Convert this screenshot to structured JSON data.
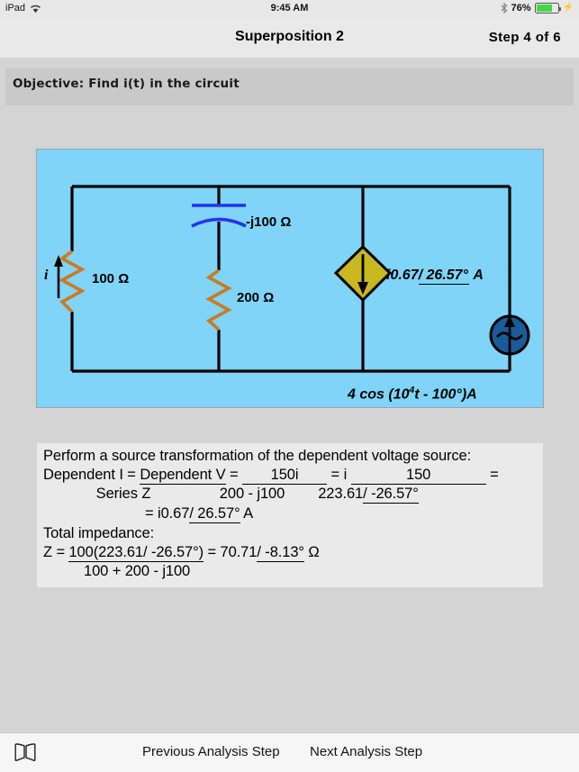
{
  "status_bar": {
    "device": "iPad",
    "wifi_icon": "wifi-icon",
    "time": "9:45 AM",
    "bluetooth_icon": "bluetooth-icon",
    "battery_percent": "76%",
    "battery_level": 76,
    "battery_charging": true
  },
  "nav": {
    "title": "Superposition 2",
    "step": "Step  4 of  6"
  },
  "objective": {
    "text": "Objective: Find i(t) in the circuit"
  },
  "circuit": {
    "background_color": "#7fd4f7",
    "wire_color": "#000000",
    "resistor_color": "#cc7a22",
    "capacitor_color": "#2233ee",
    "dependent_source_color": "#c9b820",
    "independent_source_color": "#1a5c99",
    "current_label": "i",
    "resistor_1_label": "100 Ω",
    "resistor_2_label": "200 Ω",
    "capacitor_label": "-j100 Ω",
    "dependent_source_label_prefix": "i0.67",
    "dependent_source_angle": "26.57°",
    "dependent_source_unit": "A",
    "independent_source_amplitude": "4 cos (10",
    "independent_source_exponent": "4",
    "independent_source_rest": "t - 100°)A"
  },
  "work": {
    "line1": "Perform a source transformation of the dependent voltage source:",
    "line2_a": "Dependent I = ",
    "line2_b": "Dependent V",
    "line2_c": " = ",
    "line2_d": "150i",
    "line2_e": " = i ",
    "line2_f": "150",
    "line2_g": " =",
    "line3_a": "Series Z",
    "line3_b": "200 - j100",
    "line3_c": "223.61",
    "line3_d": "/ -26.57°",
    "line4_a": "= i0.67",
    "line4_b": "/ 26.57°",
    "line4_c": " A",
    "line5": "Total impedance:",
    "line6_a": "Z = ",
    "line6_b": " 100(223.61/ -26.57°) ",
    "line6_c": " = 70.71",
    "line6_d": "/ -8.13°",
    "line6_e": " Ω",
    "line7": "100 + 200 - j100"
  },
  "toolbar": {
    "book_icon": "book-icon",
    "previous_label": "Previous Analysis Step",
    "next_label": "Next Analysis Step"
  }
}
